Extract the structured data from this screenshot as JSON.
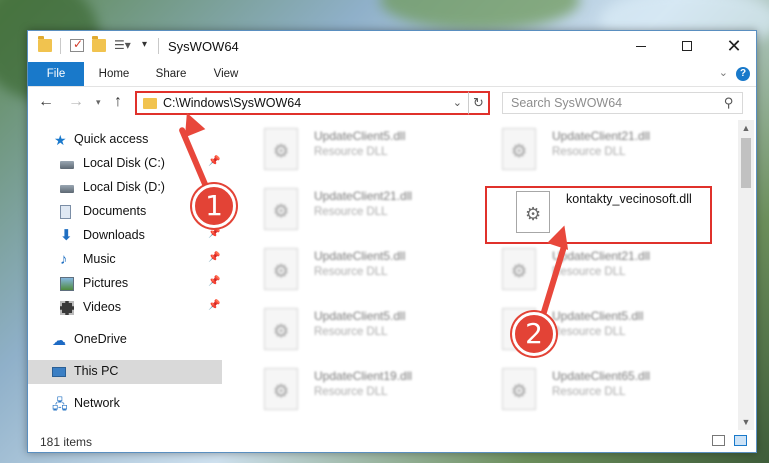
{
  "window": {
    "title": "SysWOW64"
  },
  "ribbon": {
    "tabs": [
      {
        "label": "File"
      },
      {
        "label": "Home"
      },
      {
        "label": "Share"
      },
      {
        "label": "View"
      }
    ],
    "help_glyph": "?"
  },
  "navbar": {
    "address": "C:\\Windows\\SysWOW64",
    "search_placeholder": "Search SysWOW64"
  },
  "sidebar": {
    "items": [
      {
        "label": "Quick access",
        "icon": "star-icon"
      },
      {
        "label": "Local Disk (C:)",
        "icon": "local-disk-icon",
        "pinned": true
      },
      {
        "label": "Local Disk (D:)",
        "icon": "local-disk-icon"
      },
      {
        "label": "Documents",
        "icon": "documents-icon",
        "pinned": true
      },
      {
        "label": "Downloads",
        "icon": "downloads-icon",
        "pinned": true
      },
      {
        "label": "Music",
        "icon": "music-icon",
        "pinned": true
      },
      {
        "label": "Pictures",
        "icon": "pictures-icon",
        "pinned": true
      },
      {
        "label": "Videos",
        "icon": "videos-icon",
        "pinned": true
      },
      {
        "label": "OneDrive",
        "icon": "onedrive-icon"
      },
      {
        "label": "This PC",
        "icon": "this-pc-icon",
        "selected": true
      },
      {
        "label": "Network",
        "icon": "network-icon"
      }
    ]
  },
  "files": [
    {
      "name": "UpdateClient5.dll",
      "type": "Resource DLL"
    },
    {
      "name": "UpdateClient21.dll",
      "type": "Resource DLL"
    },
    {
      "name": "UpdateClient21.dll",
      "type": "Resource DLL"
    },
    {
      "name": "kontakty_vecinosoft.dll",
      "type": ""
    },
    {
      "name": "UpdateClient5.dll",
      "type": "Resource DLL"
    },
    {
      "name": "UpdateClient21.dll",
      "type": "Resource DLL"
    },
    {
      "name": "UpdateClient5.dll",
      "type": "Resource DLL"
    },
    {
      "name": "UpdateClient5.dll",
      "type": "Resource DLL"
    },
    {
      "name": "UpdateClient19.dll",
      "type": "Resource DLL"
    },
    {
      "name": "UpdateClient65.dll",
      "type": "Resource DLL"
    }
  ],
  "status": {
    "item_count": "181 items"
  },
  "annotations": {
    "step1": "1",
    "step2": "2",
    "color": "#e34336"
  },
  "colors": {
    "accent": "#1979ca",
    "highlight": "#e0312b"
  }
}
